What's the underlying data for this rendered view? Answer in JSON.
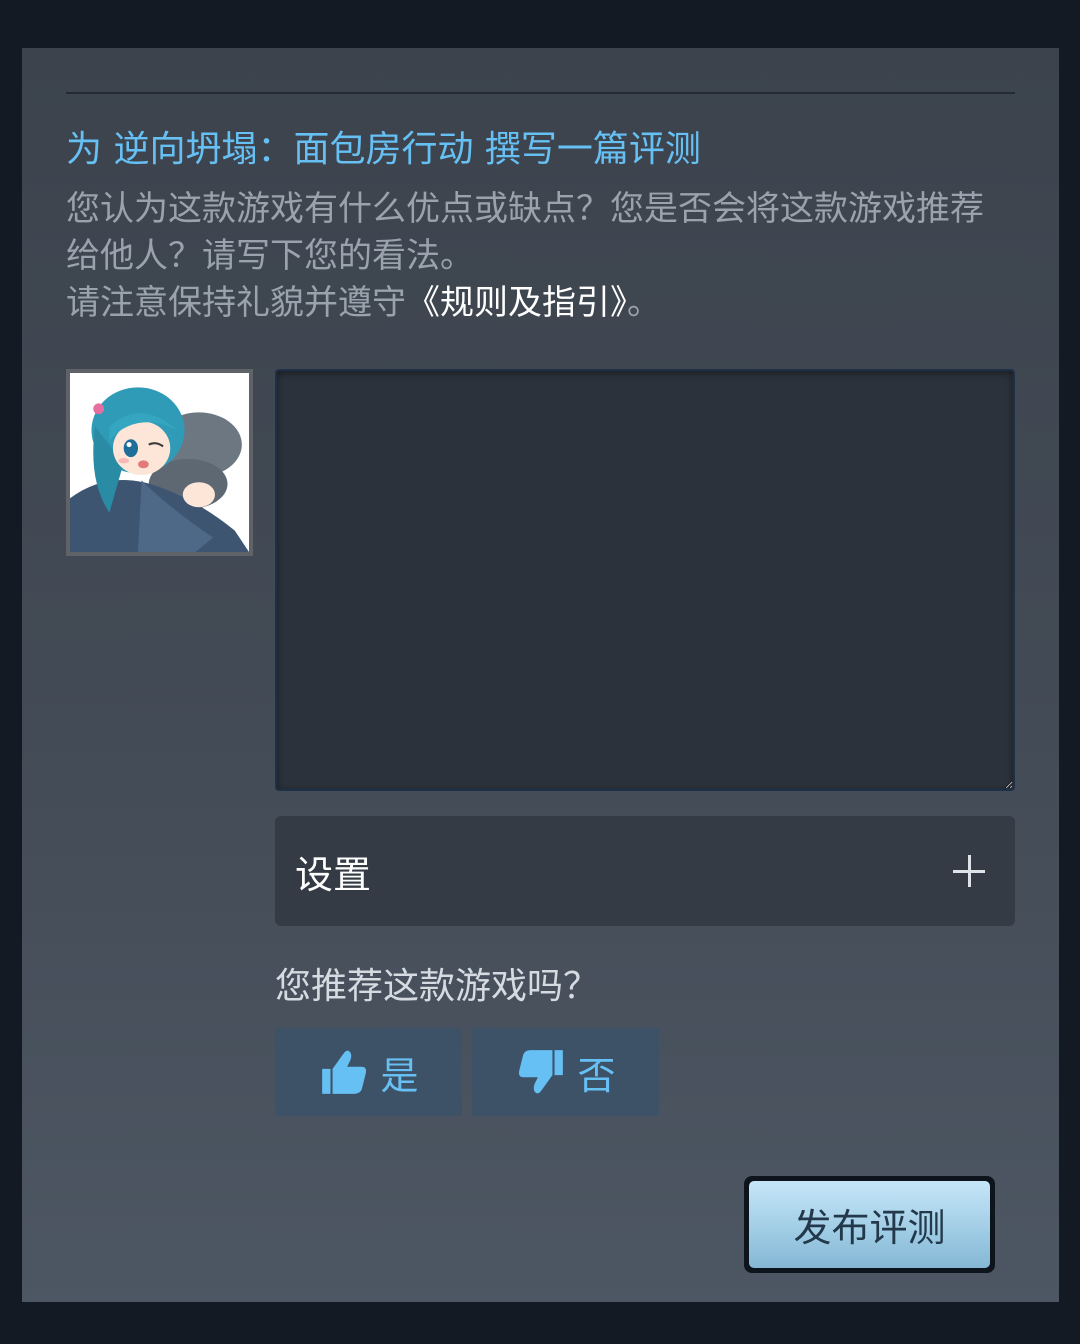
{
  "review": {
    "title": "为 逆向坍塌：面包房行动 撰写一篇评测",
    "description": "您认为这款游戏有什么优点或缺点？您是否会将这款游戏推荐给他人？请写下您的看法。",
    "etiquette_prefix": "请注意保持礼貌并遵守",
    "rules_link": "《规则及指引》",
    "etiquette_suffix": "。",
    "textarea_value": ""
  },
  "settings": {
    "label": "设置",
    "expand_icon": "plus-icon"
  },
  "recommend": {
    "question": "您推荐这款游戏吗？",
    "yes_label": "是",
    "no_label": "否",
    "yes_icon": "thumbs-up-icon",
    "no_icon": "thumbs-down-icon"
  },
  "publish": {
    "label": "发布评测"
  },
  "colors": {
    "accent": "#66c0f4",
    "panel": "#3c434d",
    "vote_button": "#3d5266"
  }
}
